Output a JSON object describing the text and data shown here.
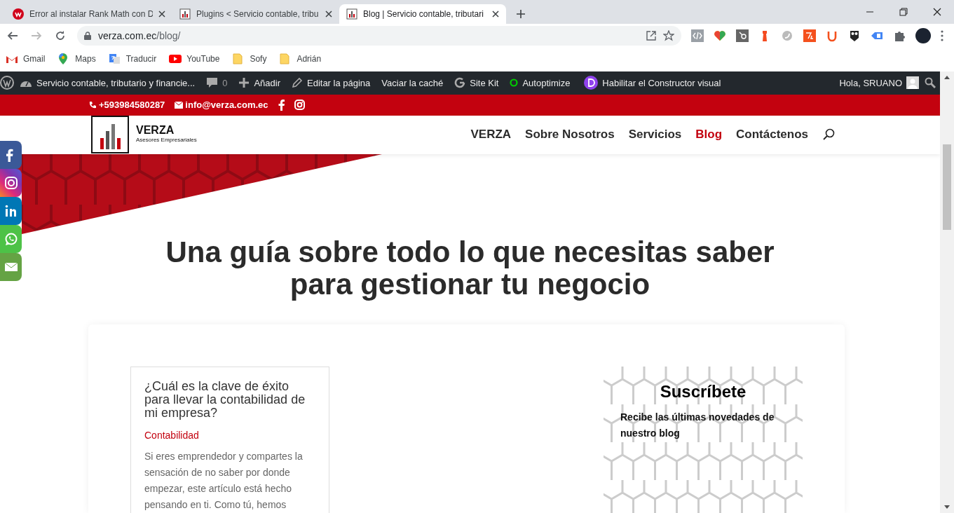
{
  "browser": {
    "tabs": [
      {
        "title": "Error al instalar Rank Math con D",
        "selected": false
      },
      {
        "title": "Plugins < Servicio contable, tribu",
        "selected": false
      },
      {
        "title": "Blog | Servicio contable, tributari",
        "selected": true
      }
    ],
    "address": {
      "host": "verza.com.ec",
      "path": "/blog/"
    },
    "bookmarks": [
      "Gmail",
      "Maps",
      "Traducir",
      "YouTube",
      "Sofy",
      "Adrián"
    ]
  },
  "admin_bar": {
    "items": [
      "Servicio contable, tributario y financie...",
      "0",
      "Añadir",
      "Editar la página",
      "Vaciar la caché",
      "Site Kit",
      "Autoptimize",
      "Habilitar el Constructor visual"
    ],
    "greeting": "Hola, SRUANO"
  },
  "top_bar": {
    "phone": "+593984580287",
    "email": "info@verza.com.ec"
  },
  "header": {
    "logo_title": "VERZA",
    "logo_subtitle": "Asesores Empresariales",
    "nav": [
      {
        "label": "VERZA",
        "selected": false
      },
      {
        "label": "Sobre Nosotros",
        "selected": false
      },
      {
        "label": "Servicios",
        "selected": false
      },
      {
        "label": "Blog",
        "selected": true
      },
      {
        "label": "Contáctenos",
        "selected": false
      }
    ]
  },
  "page_title": "Una guía sobre todo lo que necesitas saber para gestionar tu negocio",
  "post": {
    "title": "¿Cuál es la clave de éxito para llevar la contabilidad de mi empresa?",
    "category": "Contabilidad",
    "excerpt": "Si eres emprendedor y compartes la sensación de no saber por donde empezar, este artículo está hecho pensando en ti. Como tú, hemos"
  },
  "subscribe": {
    "title": "Suscríbete",
    "text": "Recibe las últimas novedades de nuestro blog"
  }
}
